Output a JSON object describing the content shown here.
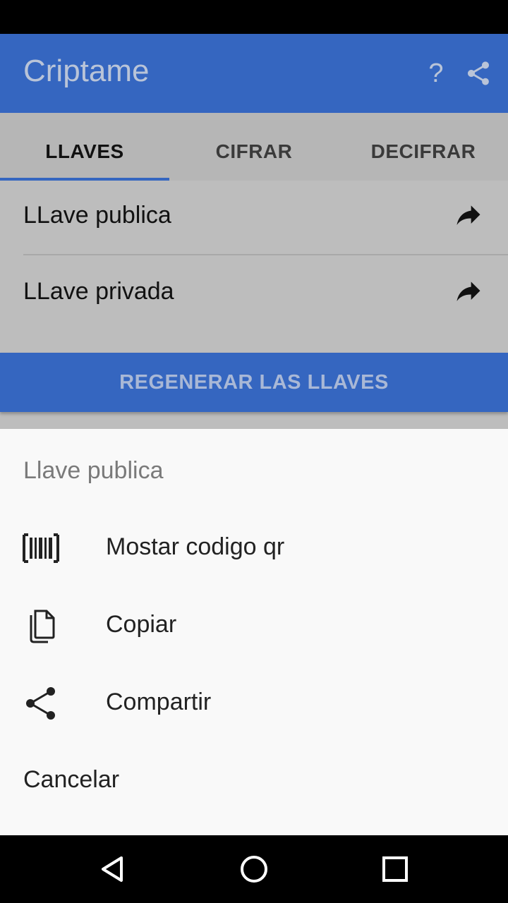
{
  "app": {
    "title": "Criptame",
    "help_glyph": "?"
  },
  "tabs": [
    {
      "label": "LLAVES",
      "active": true
    },
    {
      "label": "CIFRAR",
      "active": false
    },
    {
      "label": "DECIFRAR",
      "active": false
    }
  ],
  "keys": [
    {
      "label": "LLave publica",
      "icon": "forward-arrow-icon"
    },
    {
      "label": "LLave privada",
      "icon": "forward-arrow-icon"
    }
  ],
  "regen_button": "REGENERAR LAS LLAVES",
  "sheet": {
    "title": "Llave publica",
    "items": [
      {
        "label": "Mostar codigo qr",
        "icon": "barcode-icon"
      },
      {
        "label": "Copiar",
        "icon": "copy-icon"
      },
      {
        "label": "Compartir",
        "icon": "share-icon"
      }
    ],
    "cancel": "Cancelar"
  },
  "colors": {
    "primary": "#3566c0",
    "scrim": "#bdbdbd",
    "sheet_bg": "#f9f9f9"
  }
}
